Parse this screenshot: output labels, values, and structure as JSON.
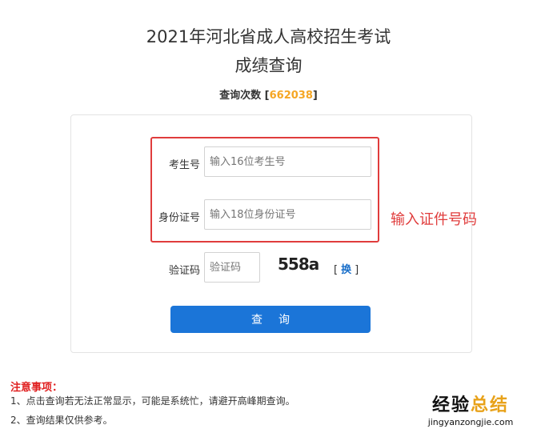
{
  "header": {
    "title_line1": "2021年河北省成人高校招生考试",
    "title_line2": "成绩查询",
    "query_count_label": "查询次数",
    "query_count_value": "662038",
    "bracket_open": "[",
    "bracket_close": "]"
  },
  "form": {
    "exam_no": {
      "label": "考生号",
      "placeholder": "输入16位考生号"
    },
    "id_no": {
      "label": "身份证号",
      "placeholder": "输入18位身份证号"
    },
    "captcha": {
      "label": "验证码",
      "placeholder": "验证码",
      "image_text": "558a",
      "refresh_label": "换",
      "bracket_open": "[",
      "bracket_close": "]"
    },
    "submit_label": "查询"
  },
  "annotation": {
    "text": "输入证件号码",
    "color": "#e03c3c"
  },
  "notes": {
    "title": "注意事项：",
    "items": [
      "1、点击查询若无法正常显示，可能是系统忙，请避开高峰期查询。",
      "2、查询结果仅供参考。"
    ]
  },
  "watermark": {
    "text_main": "经验",
    "text_accent": "总结",
    "url": "jingyanzongjie.com"
  },
  "colors": {
    "primary": "#1b75d8",
    "count": "#f5a623",
    "notice": "#e02020"
  }
}
